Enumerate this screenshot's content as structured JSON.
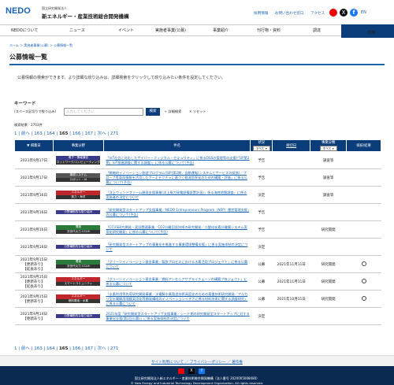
{
  "header": {
    "logo": "NEDO",
    "org_small": "国立研究開発法人",
    "org_name": "新エネルギー・産業技術総合開発機構",
    "links": [
      "採用情報",
      "お問い合わせ窓口",
      "アクセス"
    ],
    "lang": "EN"
  },
  "nav": {
    "items": [
      "NEDOについて",
      "ニュース",
      "イベント",
      "実施者事業(公募)",
      "事業紹介",
      "刊行物・資料",
      "調達"
    ],
    "search": "検索"
  },
  "breadcrumb": "ホーム ＞ 実施者事業(公募) ＞ 公募情報一覧",
  "page_title": "公募情報一覧",
  "lead": "公募情報の検索ができます。より詳細な絞り込みは、詳細検索をクリックして絞り込みたい条件を設定してください。",
  "keyword": {
    "label": "キーワード",
    "sublabel": "(スペース区切りで絞り込み)",
    "placeholder": "入力してください",
    "button": "検索",
    "advanced": "詳細検索",
    "reset": "リセット"
  },
  "result_count": "検索結果：2703件",
  "pager": {
    "first": "1",
    "prev": "前へ",
    "pages": [
      "163",
      "164",
      "165",
      "166",
      "167"
    ],
    "current": "165",
    "next": "次へ",
    "last": "271"
  },
  "table": {
    "headers": {
      "date": "掲載日",
      "category": "事業分野",
      "title": "件名",
      "status": "状況",
      "status_sel": "すべて",
      "deadline": "締切日",
      "type": "事業分類",
      "type_sel": "すべて",
      "renew": "採択/結果"
    },
    "rows": [
      {
        "date": "2021年9月17日",
        "cat1": "電子・情報通信",
        "cat2": "ネットワーク/コンピューティング",
        "c1color": "#3a3a8a",
        "title": "「IoT社会に対応したサイバー・フィジカル・セキュリティ」に係るDSSの管理等の支援(「SIP第2期」IoT推進調査に関する調査)」に係る公募について(予告)",
        "status": "予告",
        "deadline": "",
        "type": "調査等",
        "renew": ""
      },
      {
        "date": "2021年9月17日",
        "cat1": "機械システム",
        "cat2": "ロボット・AI",
        "c1color": "#555",
        "title": "「戦略的イノベーション創造プログラム(SIP)第2期／自動運転(システムとサービスの拡張)／ブローブ等車両情報を活用したアーキテクチャに基づく物流効率化のための構築・評価」に係る公募について(予告)",
        "status": "予告",
        "deadline": "",
        "type": "調査等",
        "renew": ""
      },
      {
        "date": "2021年9月16日",
        "cat1": "エネルギー",
        "cat2": "風力・海洋",
        "c1color": "#c0272d",
        "title": "「洋上ウィンドファーム開発支援事業(洋上風力発電設備設置計画)」係る海底地盤調査」に係る実施者の決定について",
        "status": "決定",
        "deadline": "",
        "type": "調査等",
        "renew": ""
      },
      {
        "date": "2021年9月16日",
        "cat1": "分野横断的な取り組み",
        "cat2": "",
        "c1color": "#3a3a8a",
        "title": "「研究開発型スタートアップ支援事業／NEDO Entrepreneurs Program（NEP）運営管理支援」の公募について(予告)",
        "status": "予告",
        "deadline": "",
        "type": "",
        "renew": ""
      },
      {
        "date": "2021年9月16日",
        "cat1": "環境",
        "cat2": "次世代火力 CCUS",
        "c1color": "#2a7a3a",
        "title": "「CCUS研究開発・実証関連事業／CO2分離回収技術の研究開発／二酸化炭素分離膜システム実用化研究開発」に係る公募について(予告)",
        "status": "予告",
        "deadline": "",
        "type": "研究開発",
        "renew": ""
      },
      {
        "date": "2021年9月16日",
        "cat1": "分野横断的な取り組み",
        "cat2": "",
        "c1color": "#3a3a8a",
        "title": "「研究開発型スタートアップの事業化を推進する事業環境整備支援」に係る実施体制の決定について",
        "status": "決定",
        "deadline": "",
        "type": "",
        "renew": ""
      },
      {
        "date": "2021年9月15日\n【更新あり】\n【延長あり】",
        "cat1": "環境",
        "cat2": "次世代火力 CCUS",
        "c1color": "#2a7a3a",
        "title": "「グリーンイノベーション基金事業／製鉄プロセスにおける水素活用プロジェクト」に係る公募について",
        "status": "公募",
        "deadline": "2021年11月11日",
        "type": "研究開発",
        "renew": "circle"
      },
      {
        "date": "2021年9月15日\n【更新あり】\n【延長あり】",
        "cat1": "エネルギー",
        "cat2": "スマートコミュニティ",
        "c1color": "#c0272d",
        "title": "「グリーンイノベーション基金事業／燃料アンモニアサプライチェーンの構築プロジェクト」に係る公募について",
        "status": "公募",
        "deadline": "2021年11月11日",
        "type": "研究開発",
        "renew": "circle"
      },
      {
        "date": "2021年9月15日\n【更新あり】",
        "cat1": "エネルギー",
        "cat2": "燃料電池・水素",
        "c1color": "#c0272d",
        "title": "「水素利用等先導研究開発事業／水電解水素製造技術高度化のための基盤技術研究開発／アルカリ型水電解用隔膜実用化等開発構成のイノベーションイデアに係る材料技術に関する調査研究」に係る公募について",
        "status": "公募",
        "deadline": "2021年10月11日",
        "type": "研究開発",
        "renew": "circle"
      },
      {
        "date": "2021年9月14日\n【更新あり】",
        "cat1": "分野横断的な取り組み",
        "cat2": "",
        "c1color": "#3a3a8a",
        "title": "2021年度「研究開発型スタートアップ支援事業／シード期の研究開発型スタートアップに対する事業化支援(第2回公募)」に係る実施体制の決定について",
        "status": "決定",
        "deadline": "",
        "type": "",
        "renew": ""
      }
    ]
  },
  "footer": {
    "links": "サイト利用について ／ プライバシーポリシー ／ 著作権",
    "corp": "国立研究開発法人新エネルギー・産業技術総合開発機構（法人番号 2020005008480）",
    "copy": "© New Energy and Industrial Technology Development Organization. All rights reserved."
  },
  "colors": {
    "primary": "#0b3d7a",
    "link": "#1a64b4"
  }
}
